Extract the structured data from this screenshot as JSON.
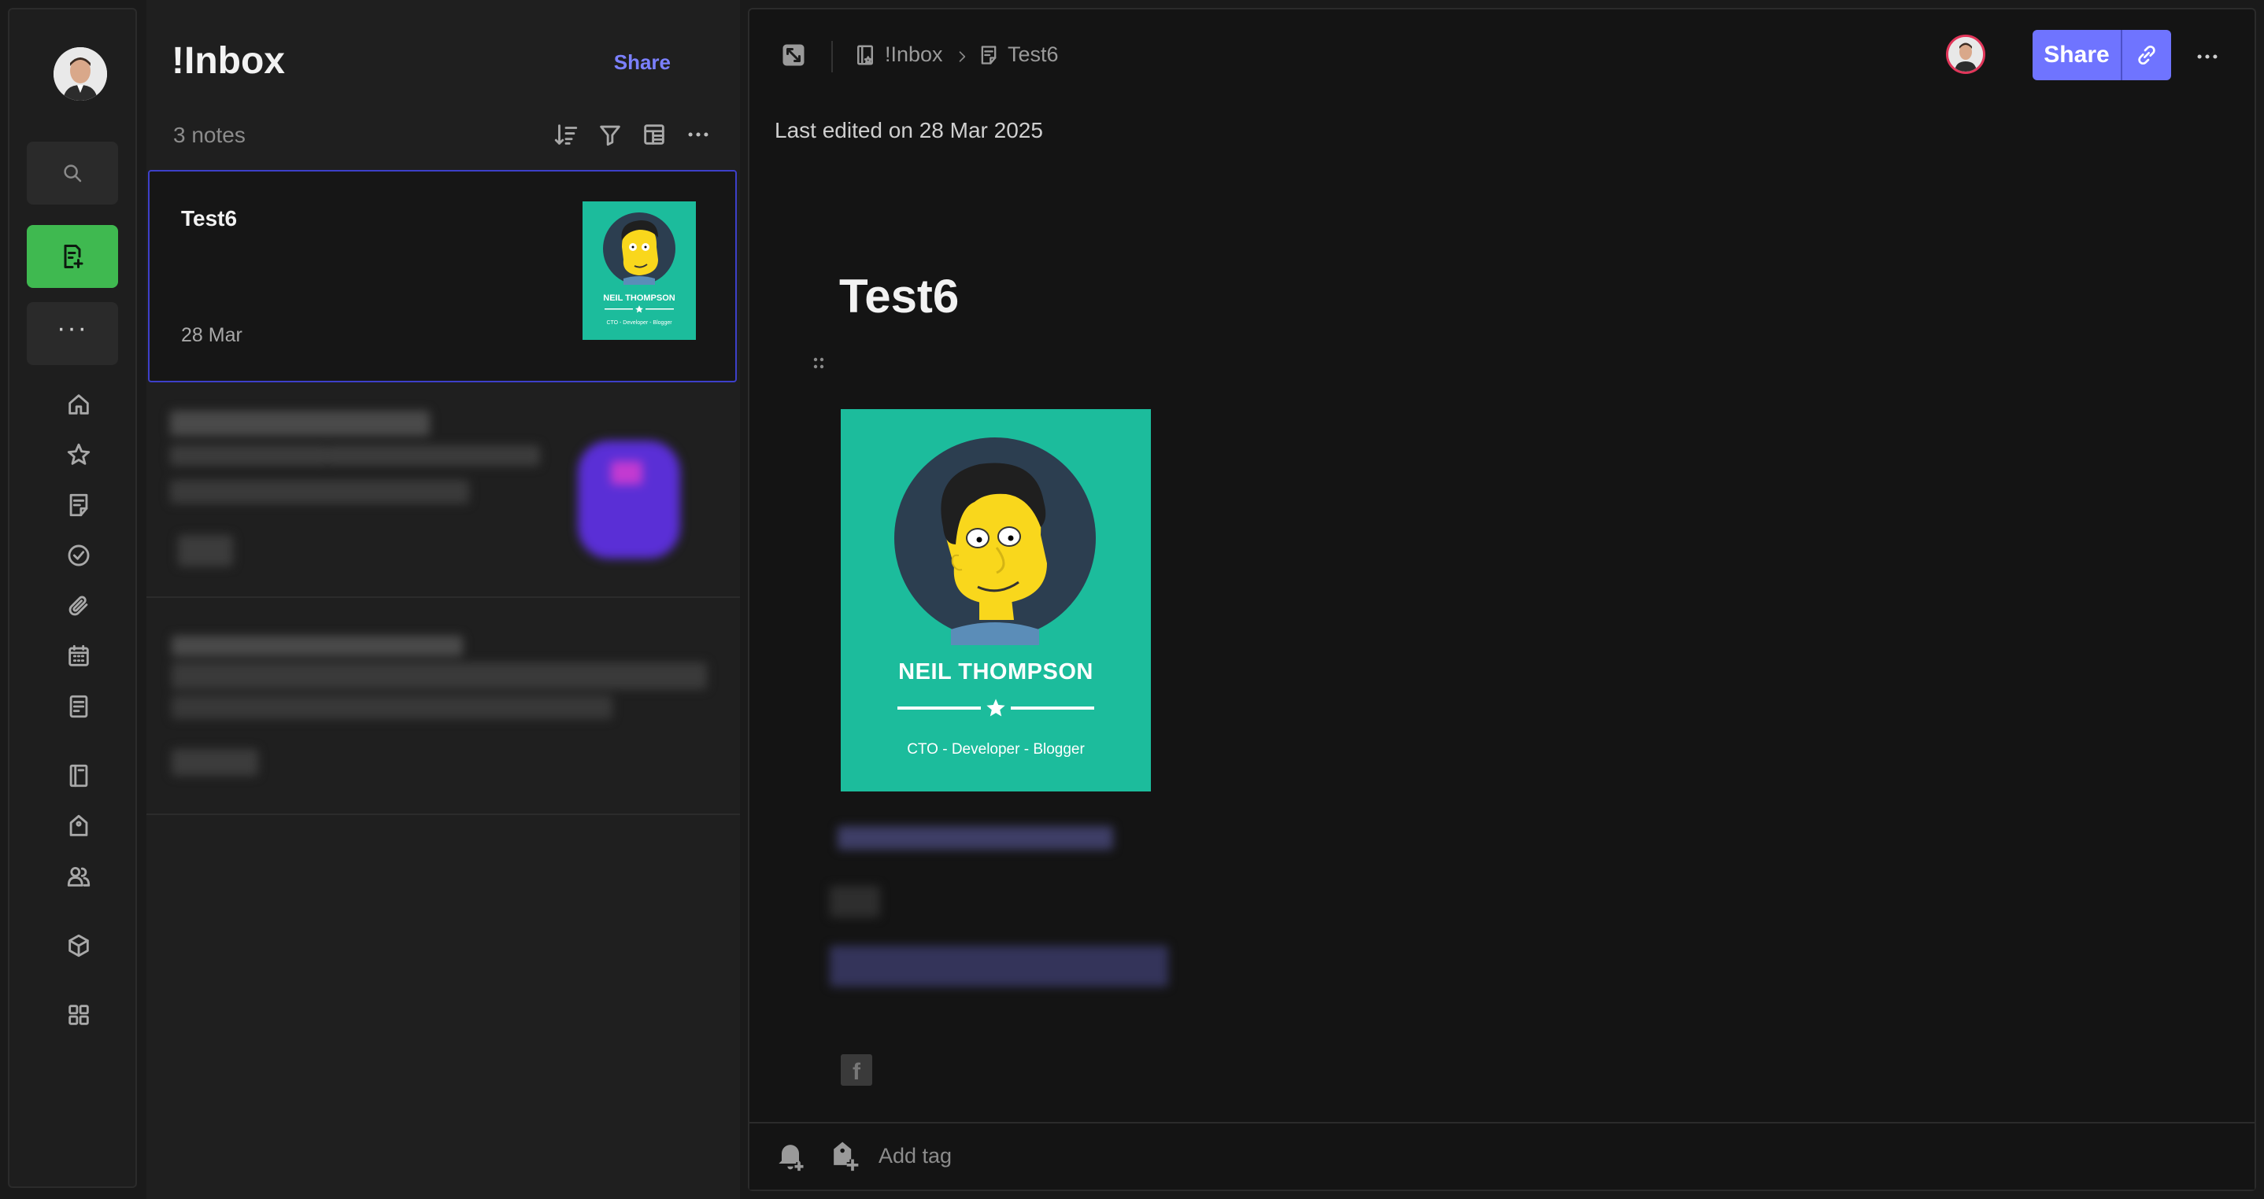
{
  "rail": {
    "items": [
      {
        "name": "search",
        "icon": "search-icon"
      },
      {
        "name": "new-note",
        "icon": "new-note-icon",
        "color": "#3fb950"
      },
      {
        "name": "more",
        "icon": "ellipsis-icon",
        "label": "···"
      },
      {
        "name": "home",
        "icon": "home-icon"
      },
      {
        "name": "shortcuts",
        "icon": "star-icon"
      },
      {
        "name": "notes",
        "icon": "note-icon"
      },
      {
        "name": "tasks",
        "icon": "check-circle-icon"
      },
      {
        "name": "files",
        "icon": "paperclip-icon"
      },
      {
        "name": "calendar",
        "icon": "calendar-icon"
      },
      {
        "name": "templates",
        "icon": "template-icon"
      },
      {
        "name": "notebooks",
        "icon": "notebook-icon"
      },
      {
        "name": "tags",
        "icon": "tag-icon"
      },
      {
        "name": "shared",
        "icon": "people-icon"
      },
      {
        "name": "spaces",
        "icon": "cube-icon"
      },
      {
        "name": "apps",
        "icon": "grid-icon"
      }
    ]
  },
  "list": {
    "title": "!Inbox",
    "share_label": "Share",
    "count_label": "3 notes",
    "tools": [
      "sort-icon",
      "filter-icon",
      "layout-icon",
      "more-icon"
    ],
    "notes": [
      {
        "title": "Test6",
        "date": "28 Mar",
        "selected": true
      }
    ]
  },
  "editor": {
    "breadcrumb": {
      "notebook": "!Inbox",
      "note": "Test6"
    },
    "share_label": "Share",
    "last_edited": "Last edited on 28 Mar 2025",
    "title": "Test6",
    "image": {
      "name": "NEIL THOMPSON",
      "tagline": "CTO - Developer - Blogger",
      "bg_color": "#1cbc9c"
    },
    "social": {
      "facebook_glyph": "f"
    },
    "footer": {
      "add_tag_label": "Add tag"
    }
  },
  "colors": {
    "accent": "#6f74ff",
    "selection_border": "#3d40c9",
    "new_note": "#3fb950"
  }
}
